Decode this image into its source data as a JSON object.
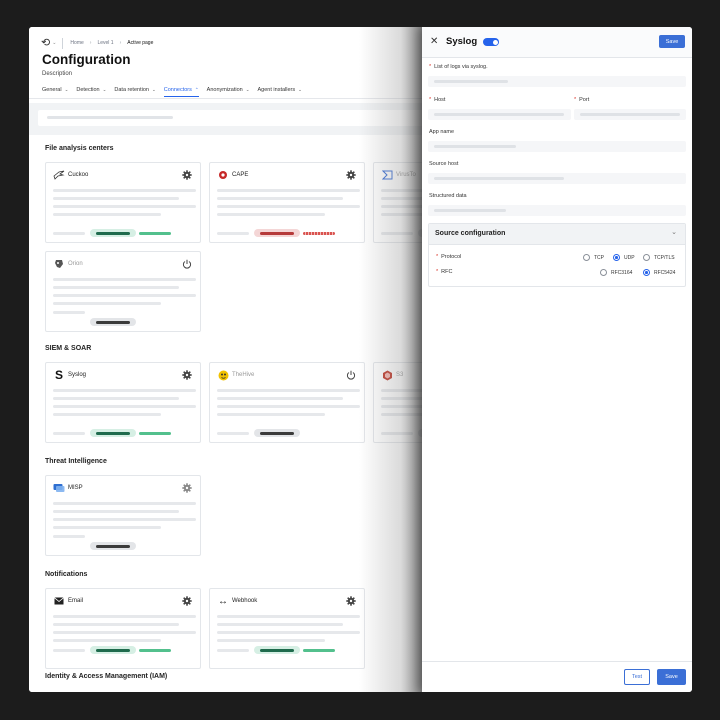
{
  "header": {
    "breadcrumb": [
      "Home",
      "Level 1",
      "Active page"
    ],
    "title": "Configuration",
    "description": "Description"
  },
  "tabs": [
    {
      "label": "General"
    },
    {
      "label": "Detection"
    },
    {
      "label": "Data retention"
    },
    {
      "label": "Connectors",
      "active": true
    },
    {
      "label": "Anonymization"
    },
    {
      "label": "Agent installers"
    }
  ],
  "sections": {
    "file_analysis": "File analysis centers",
    "siem": "SIEM & SOAR",
    "threat_intel": "Threat Intelligence",
    "notifications": "Notifications",
    "iam": "Identity & Access Management (IAM)"
  },
  "connectors": {
    "cuckoo": {
      "name": "Cuckoo",
      "icon": "cuckoo-bird-icon"
    },
    "cape": {
      "name": "CAPE",
      "icon": "cape-icon"
    },
    "virustotal": {
      "name": "VirusTo",
      "icon": "virustotal-icon"
    },
    "orion": {
      "name": "Orion",
      "icon": "orion-icon"
    },
    "syslog": {
      "name": "Syslog",
      "icon": "syslog-s-icon"
    },
    "thehive": {
      "name": "TheHive",
      "icon": "thehive-icon"
    },
    "s3": {
      "name": "S3",
      "icon": "s3-icon"
    },
    "misp": {
      "name": "MISP",
      "icon": "misp-icon"
    },
    "email": {
      "name": "Email",
      "icon": "envelope-icon"
    },
    "webhook": {
      "name": "Webhook",
      "icon": "webhook-icon"
    }
  },
  "drawer": {
    "title": "Syslog",
    "enabled": true,
    "save_label": "Save",
    "test_label": "Test",
    "fields": {
      "list_logs": "List of logs via syslog.",
      "host": "Host",
      "port": "Port",
      "app_name": "App name",
      "source_host": "Source host",
      "structured_data": "Structured data"
    },
    "source_config": {
      "title": "Source configuration",
      "protocol_label": "Protocol",
      "protocol_options": [
        "TCP",
        "UDP",
        "TCP/TLS"
      ],
      "protocol_selected": "UDP",
      "rfc_label": "RFC",
      "rfc_options": [
        "RFC3164",
        "RFC5424"
      ],
      "rfc_selected": "RFC5424"
    }
  },
  "colors": {
    "accent": "#2563eb",
    "button": "#3b6fd6",
    "status_green": "#53c08d",
    "status_red": "#d9534f"
  }
}
